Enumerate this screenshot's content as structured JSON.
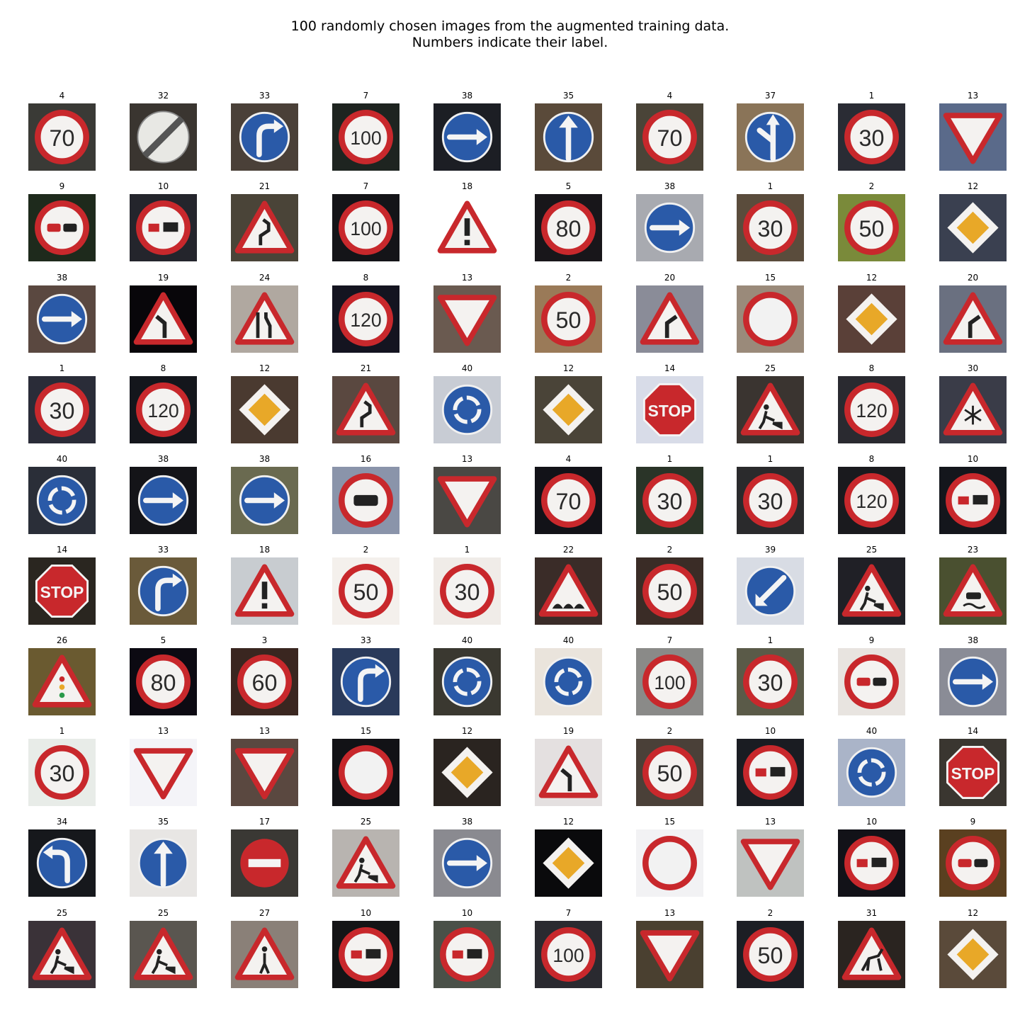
{
  "title_line1": "100 randomly chosen images from the augmented training data.",
  "title_line2": "Numbers indicate their label.",
  "images": [
    {
      "label": "4",
      "icon": "speed-limit-icon",
      "text": "70",
      "bg": "#3a3a36"
    },
    {
      "label": "32",
      "icon": "end-restrictions-icon",
      "text": "",
      "bg": "#3a3530"
    },
    {
      "label": "33",
      "icon": "turn-right-icon",
      "text": "",
      "bg": "#4a4038"
    },
    {
      "label": "7",
      "icon": "speed-limit-icon",
      "text": "100",
      "bg": "#1e2420"
    },
    {
      "label": "38",
      "icon": "keep-right-icon",
      "text": "",
      "bg": "#1c1e24"
    },
    {
      "label": "35",
      "icon": "ahead-only-icon",
      "text": "",
      "bg": "#5a4a3a"
    },
    {
      "label": "4",
      "icon": "speed-limit-icon",
      "text": "70",
      "bg": "#4a4438"
    },
    {
      "label": "37",
      "icon": "straight-or-left-icon",
      "text": "",
      "bg": "#8a7458"
    },
    {
      "label": "1",
      "icon": "speed-limit-icon",
      "text": "30",
      "bg": "#2a2c34"
    },
    {
      "label": "13",
      "icon": "yield-icon",
      "text": "",
      "bg": "#5a6a8a"
    },
    {
      "label": "9",
      "icon": "no-passing-icon",
      "text": "",
      "bg": "#1e2a1c"
    },
    {
      "label": "10",
      "icon": "no-passing-trucks-icon",
      "text": "",
      "bg": "#24252c"
    },
    {
      "label": "21",
      "icon": "double-curve-icon",
      "text": "",
      "bg": "#4a4438"
    },
    {
      "label": "7",
      "icon": "speed-limit-icon",
      "text": "100",
      "bg": "#141418"
    },
    {
      "label": "18",
      "icon": "general-caution-icon",
      "text": "!",
      "bg": "#ffffff"
    },
    {
      "label": "5",
      "icon": "speed-limit-icon",
      "text": "80",
      "bg": "#18161a"
    },
    {
      "label": "38",
      "icon": "keep-right-icon",
      "text": "",
      "bg": "#a8aab0"
    },
    {
      "label": "1",
      "icon": "speed-limit-icon",
      "text": "30",
      "bg": "#5a4c3c"
    },
    {
      "label": "2",
      "icon": "speed-limit-icon",
      "text": "50",
      "bg": "#7a8a3a"
    },
    {
      "label": "12",
      "icon": "priority-road-icon",
      "text": "",
      "bg": "#3a4050"
    },
    {
      "label": "38",
      "icon": "keep-right-icon",
      "text": "",
      "bg": "#5a4840"
    },
    {
      "label": "19",
      "icon": "curve-left-icon",
      "text": "",
      "bg": "#08060a"
    },
    {
      "label": "24",
      "icon": "road-narrows-icon",
      "text": "",
      "bg": "#b0a8a0"
    },
    {
      "label": "8",
      "icon": "speed-limit-icon",
      "text": "120",
      "bg": "#141420"
    },
    {
      "label": "13",
      "icon": "yield-icon",
      "text": "",
      "bg": "#6a5a50"
    },
    {
      "label": "2",
      "icon": "speed-limit-icon",
      "text": "50",
      "bg": "#9a7a58"
    },
    {
      "label": "20",
      "icon": "curve-right-icon",
      "text": "",
      "bg": "#8a8c98"
    },
    {
      "label": "15",
      "icon": "no-vehicles-icon",
      "text": "",
      "bg": "#9a8a7a"
    },
    {
      "label": "12",
      "icon": "priority-road-icon",
      "text": "",
      "bg": "#5a4038"
    },
    {
      "label": "20",
      "icon": "curve-right-icon",
      "text": "",
      "bg": "#6a7080"
    },
    {
      "label": "1",
      "icon": "speed-limit-icon",
      "text": "30",
      "bg": "#2a2c38"
    },
    {
      "label": "8",
      "icon": "speed-limit-icon",
      "text": "120",
      "bg": "#14161c"
    },
    {
      "label": "12",
      "icon": "priority-road-icon",
      "text": "",
      "bg": "#4a3a30"
    },
    {
      "label": "21",
      "icon": "double-curve-icon",
      "text": "",
      "bg": "#5a4840"
    },
    {
      "label": "40",
      "icon": "roundabout-icon",
      "text": "",
      "bg": "#c8ccd4"
    },
    {
      "label": "12",
      "icon": "priority-road-icon",
      "text": "",
      "bg": "#4a4438"
    },
    {
      "label": "14",
      "icon": "stop-icon",
      "text": "STOP",
      "bg": "#d8dce8"
    },
    {
      "label": "25",
      "icon": "road-work-icon",
      "text": "",
      "bg": "#3a3430"
    },
    {
      "label": "8",
      "icon": "speed-limit-icon",
      "text": "120",
      "bg": "#2a2a30"
    },
    {
      "label": "30",
      "icon": "ice-snow-icon",
      "text": "",
      "bg": "#3a3c48"
    },
    {
      "label": "40",
      "icon": "roundabout-icon",
      "text": "",
      "bg": "#2a2e38"
    },
    {
      "label": "38",
      "icon": "keep-right-icon",
      "text": "",
      "bg": "#141418"
    },
    {
      "label": "38",
      "icon": "keep-right-icon",
      "text": "",
      "bg": "#6a6a50"
    },
    {
      "label": "16",
      "icon": "no-trucks-icon",
      "text": "",
      "bg": "#8a94aa"
    },
    {
      "label": "13",
      "icon": "yield-icon",
      "text": "",
      "bg": "#4a4844"
    },
    {
      "label": "4",
      "icon": "speed-limit-icon",
      "text": "70",
      "bg": "#121218"
    },
    {
      "label": "1",
      "icon": "speed-limit-icon",
      "text": "30",
      "bg": "#2a3428"
    },
    {
      "label": "1",
      "icon": "speed-limit-icon",
      "text": "30",
      "bg": "#2a2a2c"
    },
    {
      "label": "8",
      "icon": "speed-limit-icon",
      "text": "120",
      "bg": "#1a1a1e"
    },
    {
      "label": "10",
      "icon": "no-passing-trucks-icon",
      "text": "",
      "bg": "#14161c"
    },
    {
      "label": "14",
      "icon": "stop-icon",
      "text": "STOP",
      "bg": "#2a2620"
    },
    {
      "label": "33",
      "icon": "turn-right-icon",
      "text": "",
      "bg": "#6a5a3a"
    },
    {
      "label": "18",
      "icon": "general-caution-icon",
      "text": "!",
      "bg": "#c8ccd0"
    },
    {
      "label": "2",
      "icon": "speed-limit-icon",
      "text": "50",
      "bg": "#f4f0ec"
    },
    {
      "label": "1",
      "icon": "speed-limit-icon",
      "text": "30",
      "bg": "#f0ece8"
    },
    {
      "label": "22",
      "icon": "bumpy-road-icon",
      "text": "",
      "bg": "#3a2c28"
    },
    {
      "label": "2",
      "icon": "speed-limit-icon",
      "text": "50",
      "bg": "#3a2c26"
    },
    {
      "label": "39",
      "icon": "keep-left-icon",
      "text": "",
      "bg": "#d8dce4"
    },
    {
      "label": "25",
      "icon": "road-work-icon",
      "text": "",
      "bg": "#202026"
    },
    {
      "label": "23",
      "icon": "slippery-road-icon",
      "text": "",
      "bg": "#4a5030"
    },
    {
      "label": "26",
      "icon": "traffic-signals-icon",
      "text": "",
      "bg": "#6a5a30"
    },
    {
      "label": "5",
      "icon": "speed-limit-icon",
      "text": "80",
      "bg": "#0c0a12"
    },
    {
      "label": "3",
      "icon": "speed-limit-icon",
      "text": "60",
      "bg": "#3a2620"
    },
    {
      "label": "33",
      "icon": "turn-right-icon",
      "text": "",
      "bg": "#2a3a5a"
    },
    {
      "label": "40",
      "icon": "roundabout-icon",
      "text": "",
      "bg": "#3a3830"
    },
    {
      "label": "40",
      "icon": "roundabout-icon",
      "text": "",
      "bg": "#eae4dc"
    },
    {
      "label": "7",
      "icon": "speed-limit-icon",
      "text": "100",
      "bg": "#8a8a88"
    },
    {
      "label": "1",
      "icon": "speed-limit-icon",
      "text": "30",
      "bg": "#5a5a48"
    },
    {
      "label": "9",
      "icon": "no-passing-icon",
      "text": "",
      "bg": "#e8e4e0"
    },
    {
      "label": "38",
      "icon": "keep-right-icon",
      "text": "",
      "bg": "#8a8c96"
    },
    {
      "label": "1",
      "icon": "speed-limit-icon",
      "text": "30",
      "bg": "#e8ece8"
    },
    {
      "label": "13",
      "icon": "yield-icon",
      "text": "",
      "bg": "#f4f4f8"
    },
    {
      "label": "13",
      "icon": "yield-icon",
      "text": "",
      "bg": "#5a4840"
    },
    {
      "label": "15",
      "icon": "no-vehicles-icon",
      "text": "",
      "bg": "#121216"
    },
    {
      "label": "12",
      "icon": "priority-road-icon",
      "text": "",
      "bg": "#2a2420"
    },
    {
      "label": "19",
      "icon": "curve-left-icon",
      "text": "",
      "bg": "#e4e0e0"
    },
    {
      "label": "2",
      "icon": "speed-limit-icon",
      "text": "50",
      "bg": "#4a4038"
    },
    {
      "label": "10",
      "icon": "no-passing-trucks-icon",
      "text": "",
      "bg": "#1a1c22"
    },
    {
      "label": "40",
      "icon": "roundabout-icon",
      "text": "",
      "bg": "#aab4c8"
    },
    {
      "label": "14",
      "icon": "stop-icon",
      "text": "STOP",
      "bg": "#3a3630"
    },
    {
      "label": "34",
      "icon": "turn-left-icon",
      "text": "",
      "bg": "#16181c"
    },
    {
      "label": "35",
      "icon": "ahead-only-icon",
      "text": "",
      "bg": "#e8e6e4"
    },
    {
      "label": "17",
      "icon": "no-entry-icon",
      "text": "",
      "bg": "#3a3834"
    },
    {
      "label": "25",
      "icon": "road-work-icon",
      "text": "",
      "bg": "#b8b4b0"
    },
    {
      "label": "38",
      "icon": "keep-right-icon",
      "text": "",
      "bg": "#8a8a90"
    },
    {
      "label": "12",
      "icon": "priority-road-icon",
      "text": "",
      "bg": "#0a0a0c"
    },
    {
      "label": "15",
      "icon": "no-vehicles-icon",
      "text": "",
      "bg": "#f2f2f4"
    },
    {
      "label": "13",
      "icon": "yield-icon",
      "text": "",
      "bg": "#bfc2c0"
    },
    {
      "label": "10",
      "icon": "no-passing-trucks-icon",
      "text": "",
      "bg": "#121218"
    },
    {
      "label": "9",
      "icon": "no-passing-icon",
      "text": "",
      "bg": "#5a4020"
    },
    {
      "label": "25",
      "icon": "road-work-icon",
      "text": "",
      "bg": "#3a3238"
    },
    {
      "label": "25",
      "icon": "road-work-icon",
      "text": "",
      "bg": "#5a5650"
    },
    {
      "label": "27",
      "icon": "pedestrians-icon",
      "text": "",
      "bg": "#8a8078"
    },
    {
      "label": "10",
      "icon": "no-passing-trucks-icon",
      "text": "",
      "bg": "#141416"
    },
    {
      "label": "10",
      "icon": "no-passing-trucks-icon",
      "text": "",
      "bg": "#4a5048"
    },
    {
      "label": "7",
      "icon": "speed-limit-icon",
      "text": "100",
      "bg": "#2a2a30"
    },
    {
      "label": "13",
      "icon": "yield-icon",
      "text": "",
      "bg": "#4a4030"
    },
    {
      "label": "2",
      "icon": "speed-limit-icon",
      "text": "50",
      "bg": "#1c1e24"
    },
    {
      "label": "31",
      "icon": "wild-animals-icon",
      "text": "",
      "bg": "#2a2420"
    },
    {
      "label": "12",
      "icon": "priority-road-icon",
      "text": "",
      "bg": "#5a4a3a"
    }
  ]
}
